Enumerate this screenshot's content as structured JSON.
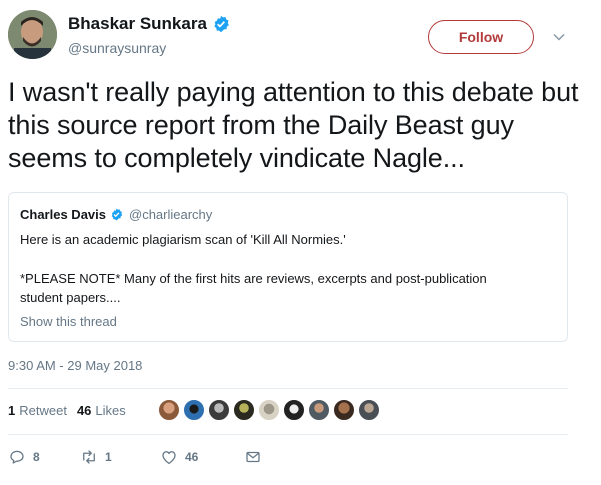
{
  "author": {
    "display_name": "Bhaskar Sunkara",
    "handle": "@sunraysunray"
  },
  "follow_label": "Follow",
  "tweet_text": "I wasn't really paying attention to this debate but this source report from the Daily Beast guy seems to completely vindicate Nagle...",
  "quoted": {
    "display_name": "Charles Davis",
    "handle": "@charliearchy",
    "line1": "Here is an academic plagiarism scan of 'Kill All Normies.'",
    "line2": "*PLEASE NOTE* Many of the first hits are reviews, excerpts and post-publication",
    "line3": "student papers....",
    "show_thread": "Show this thread"
  },
  "timestamp": "9:30 AM - 29 May 2018",
  "stats": {
    "retweets_count": "1",
    "retweets_label": "Retweet",
    "likes_count": "46",
    "likes_label": "Likes"
  },
  "actions": {
    "replies": "8",
    "retweets": "1",
    "likes": "46"
  },
  "colors": {
    "follow_red": "#b33a3a",
    "verified_blue": "#1da1f2",
    "muted": "#657786"
  },
  "icons": [
    "verified-badge-icon",
    "chevron-down-icon",
    "reply-icon",
    "retweet-icon",
    "heart-icon",
    "message-icon"
  ]
}
